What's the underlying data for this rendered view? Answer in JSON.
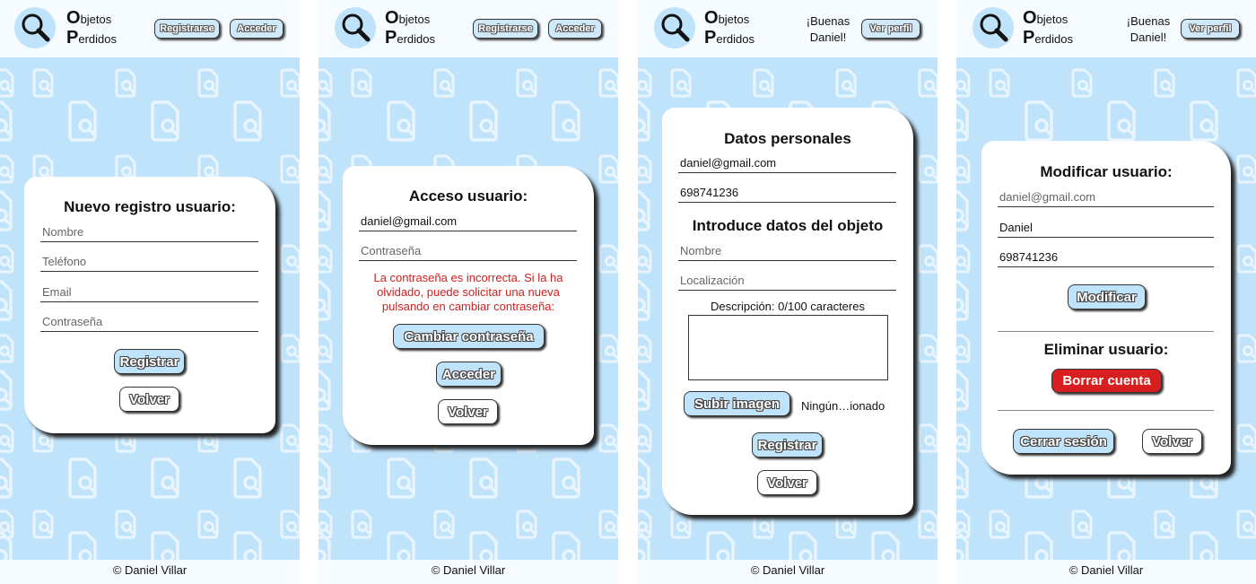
{
  "brand": {
    "initial1": "O",
    "rest1": "bjetos",
    "initial2": "P",
    "rest2": "erdidos"
  },
  "footer": "© Daniel Villar",
  "colors": {
    "background": "#bfe3fb",
    "card": "#ffffff",
    "danger": "#d81f1f",
    "error_text": "#d21f1f"
  },
  "icons": {
    "logo": "magnifier-icon",
    "pattern": "document-search-icon"
  },
  "screens": [
    {
      "header": {
        "btn1": "Registrarse",
        "btn2": "Acceder"
      },
      "title": "Nuevo registro usuario:",
      "fields": [
        "Nombre",
        "Teléfono",
        "Email",
        "Contraseña"
      ],
      "primary": "Registrar",
      "back": "Volver"
    },
    {
      "header": {
        "btn1": "Registrarse",
        "btn2": "Acceder"
      },
      "title": "Acceso usuario:",
      "email_value": "daniel@gmail.com",
      "password_placeholder": "Contraseña",
      "error_lines": [
        "La contraseña es incorrecta. Si la ha",
        "olvidado, puede solicitar una nueva",
        "pulsando en cambiar contraseña:"
      ],
      "change_password": "Cambiar contraseña",
      "primary": "Acceder",
      "back": "Volver"
    },
    {
      "header": {
        "greet1": "¡Buenas",
        "greet2": "Daniel!",
        "btn": "Ver perfil"
      },
      "title_personal": "Datos personales",
      "email_value": "daniel@gmail.com",
      "phone_value": "698741236",
      "title_object": "Introduce datos del objeto",
      "name_placeholder": "Nombre",
      "location_placeholder": "Localización",
      "description_label": "Descripción: 0/100 caracteres",
      "upload": "Subir imagen",
      "file_status": "Ningún…ionado",
      "primary": "Registrar",
      "back": "Volver"
    },
    {
      "header": {
        "greet1": "¡Buenas",
        "greet2": "Daniel!",
        "btn": "Ver perfil"
      },
      "title_modify": "Modificar usuario:",
      "email_placeholder": "daniel@gmail.com",
      "name_value": "Daniel",
      "phone_value": "698741236",
      "modify": "Modificar",
      "title_delete": "Eliminar usuario:",
      "delete": "Borrar cuenta",
      "logout": "Cerrar sesión",
      "back": "Volver"
    }
  ]
}
